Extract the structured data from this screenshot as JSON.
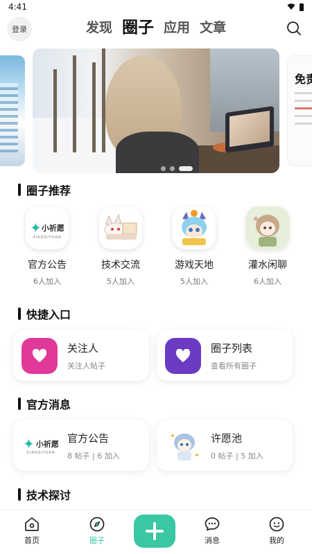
{
  "status_bar": {
    "time": "4:41"
  },
  "header": {
    "login_label": "登录",
    "tabs": [
      {
        "label": "发现",
        "active": false
      },
      {
        "label": "圈子",
        "active": true
      },
      {
        "label": "应用",
        "active": false
      },
      {
        "label": "文章",
        "active": false
      }
    ]
  },
  "banner": {
    "right_preview_text": "免责",
    "page_count": 3,
    "active_page": 1
  },
  "sections": {
    "recommend_title": "圈子推荐",
    "shortcut_title": "快捷入口",
    "official_title": "官方消息",
    "tech_title": "技术探讨"
  },
  "recommended": [
    {
      "name": "官方公告",
      "count": "6人加入",
      "logo_text": "小祈愿",
      "logo_sub": "XIAOQIYUAN"
    },
    {
      "name": "技术交流",
      "count": "5人加入"
    },
    {
      "name": "游戏天地",
      "count": "5人加入"
    },
    {
      "name": "灌水闲聊",
      "count": "6人加入"
    }
  ],
  "shortcuts": [
    {
      "title": "关注人",
      "subtitle": "关注人帖子",
      "color": "#e0399a",
      "icon": "heart-icon"
    },
    {
      "title": "圈子列表",
      "subtitle": "查看所有圈子",
      "color": "#6b3bc4",
      "icon": "heart-icon"
    }
  ],
  "official": [
    {
      "title": "官方公告",
      "subtitle": "8 帖子 | 6 加入",
      "logo_text": "小祈愿",
      "logo_sub": "XIAOQIYUAN"
    },
    {
      "title": "许愿池",
      "subtitle": "0 帖子 | 5 加入"
    }
  ],
  "bottom_nav": [
    {
      "label": "首页",
      "icon": "home-icon",
      "active": false
    },
    {
      "label": "圈子",
      "icon": "compass-icon",
      "active": true
    },
    {
      "label": "消息",
      "icon": "message-icon",
      "active": false
    },
    {
      "label": "我的",
      "icon": "profile-icon",
      "active": false
    }
  ],
  "colors": {
    "accent": "#3bc7a3",
    "heart_pink": "#e0399a",
    "heart_purple": "#6b3bc4"
  }
}
